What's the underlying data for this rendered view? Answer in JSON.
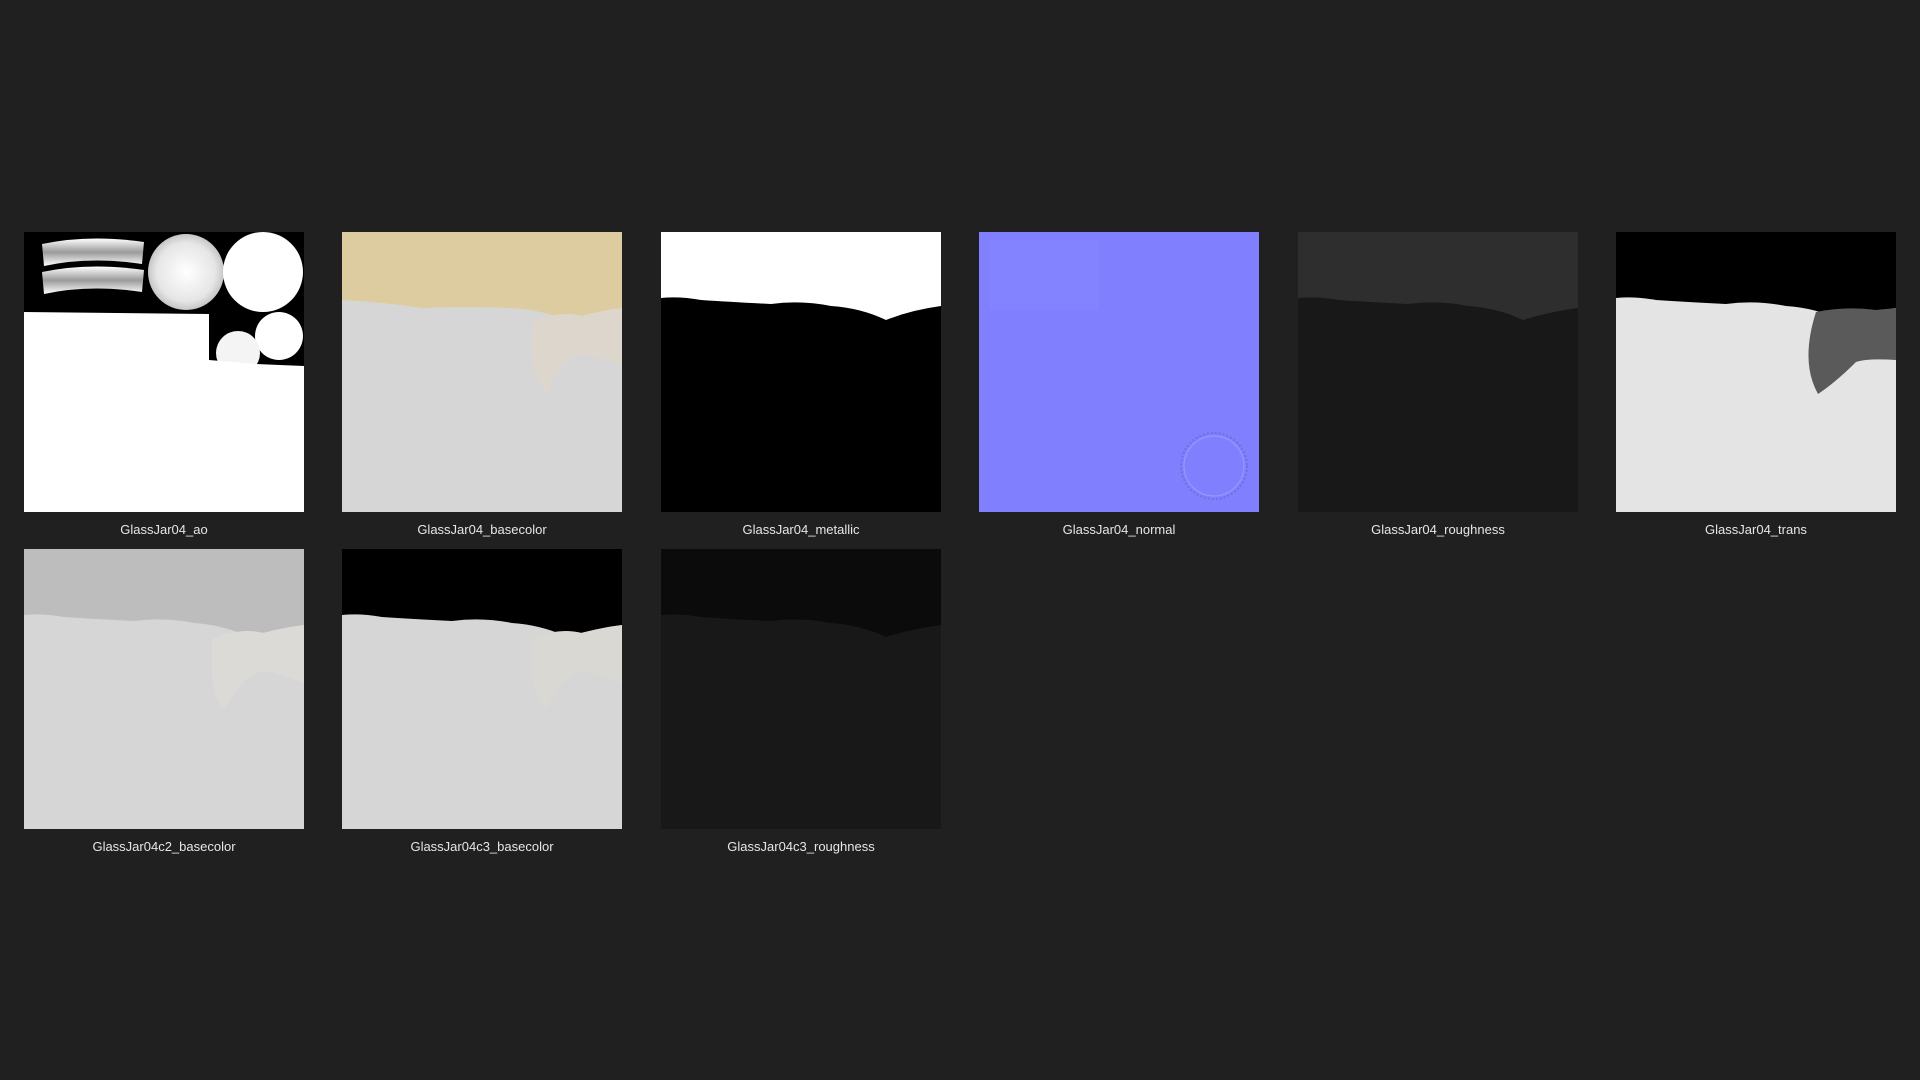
{
  "files": [
    {
      "name": "GlassJar04_ao"
    },
    {
      "name": "GlassJar04_basecolor"
    },
    {
      "name": "GlassJar04_metallic"
    },
    {
      "name": "GlassJar04_normal"
    },
    {
      "name": "GlassJar04_roughness"
    },
    {
      "name": "GlassJar04_trans"
    },
    {
      "name": "GlassJar04c2_basecolor"
    },
    {
      "name": "GlassJar04c3_basecolor"
    },
    {
      "name": "GlassJar04c3_roughness"
    }
  ],
  "colors": {
    "background": "#202020",
    "label_text": "#e6e6e6",
    "basecolor_tint": "#dccca0",
    "normal_blue": "#8080ff"
  }
}
